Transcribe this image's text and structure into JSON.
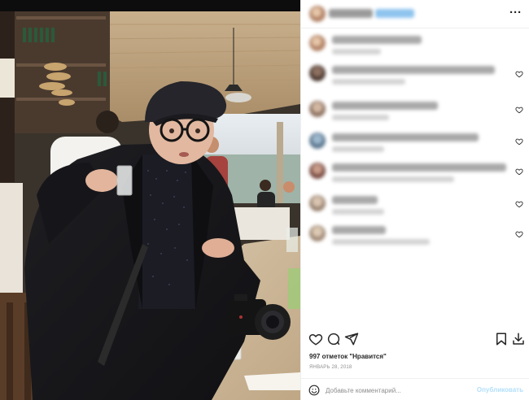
{
  "post": {
    "likes_text": "997 отметок \"Нравится\"",
    "date_text": "ЯНВАРЬ 28, 2018"
  },
  "comment_box": {
    "placeholder": "Добавьте комментарий...",
    "publish_label": "Опубликовать"
  },
  "header": {
    "more_icon": "more-horizontal-icon",
    "more_glyph": "···"
  },
  "colors": {
    "accent_blue": "#b2dffc",
    "text": "#262626",
    "muted": "#8e8e8e",
    "divider": "#efefef"
  },
  "icons": [
    "heart-icon",
    "comment-icon",
    "share-icon",
    "bookmark-icon",
    "download-icon",
    "emoji-icon",
    "more-horizontal-icon"
  ]
}
